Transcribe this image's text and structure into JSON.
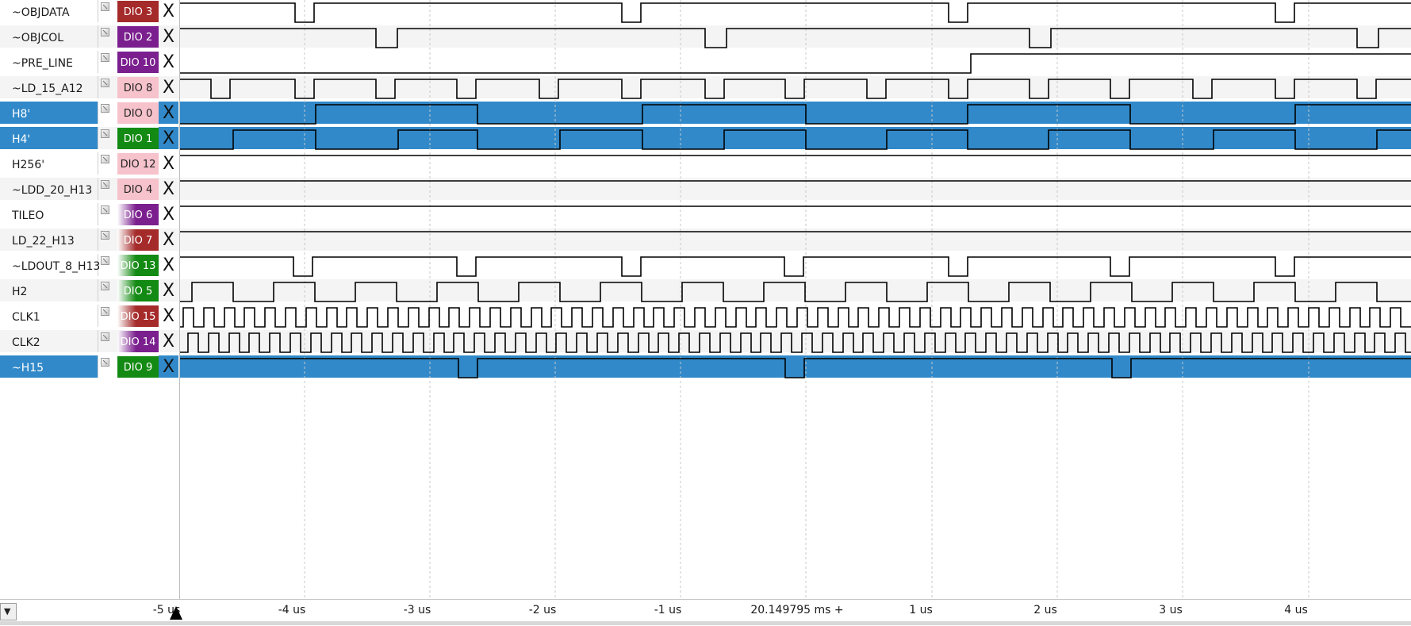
{
  "channels": [
    {
      "name": "~OBJDATA",
      "dio": "DIO  3",
      "color": "#a52a2a",
      "style": "solid",
      "selected": false
    },
    {
      "name": "~OBJCOL",
      "dio": "DIO  2",
      "color": "#7b1f8f",
      "style": "solid",
      "selected": false
    },
    {
      "name": "~PRE_LINE",
      "dio": "DIO 10",
      "color": "#7b1f8f",
      "style": "solid",
      "selected": false
    },
    {
      "name": "~LD_15_A12",
      "dio": "DIO  8",
      "color": "#f6c2cb",
      "style": "pink",
      "selected": false
    },
    {
      "name": "H8'",
      "dio": "DIO  0",
      "color": "#f6c2cb",
      "style": "pink",
      "selected": true
    },
    {
      "name": "H4'",
      "dio": "DIO  1",
      "color": "#138a13",
      "style": "solid",
      "selected": true
    },
    {
      "name": "H256'",
      "dio": "DIO 12",
      "color": "#f6c2cb",
      "style": "pink",
      "selected": false
    },
    {
      "name": "~LDD_20_H13",
      "dio": "DIO  4",
      "color": "#f6c2cb",
      "style": "pink",
      "selected": false
    },
    {
      "name": "TILEO",
      "dio": "DIO  6",
      "color": "#7b1f8f",
      "style": "fade",
      "selected": false
    },
    {
      "name": "LD_22_H13",
      "dio": "DIO  7",
      "color": "#a52a2a",
      "style": "fade",
      "selected": false
    },
    {
      "name": "~LDOUT_8_H13",
      "dio": "DIO 13",
      "color": "#138a13",
      "style": "fade",
      "selected": false
    },
    {
      "name": "H2",
      "dio": "DIO  5",
      "color": "#138a13",
      "style": "fade",
      "selected": false
    },
    {
      "name": "CLK1",
      "dio": "DIO 15",
      "color": "#a52a2a",
      "style": "fade",
      "selected": false
    },
    {
      "name": "CLK2",
      "dio": "DIO 14",
      "color": "#7b1f8f",
      "style": "fade",
      "selected": false
    },
    {
      "name": "~H15",
      "dio": "DIO  9",
      "color": "#138a13",
      "style": "solid",
      "selected": true
    }
  ],
  "trigger_glyph": "X",
  "ruler": {
    "ticks": [
      "-5 us",
      "-4 us",
      "-3 us",
      "-2 us",
      "-1 us",
      "20.149795 ms +",
      "1 us",
      "2 us",
      "3 us",
      "4 us"
    ]
  },
  "colors": {
    "selected_row": "#3189c9",
    "alt_row": "#f4f4f4",
    "trace": "#000000"
  }
}
